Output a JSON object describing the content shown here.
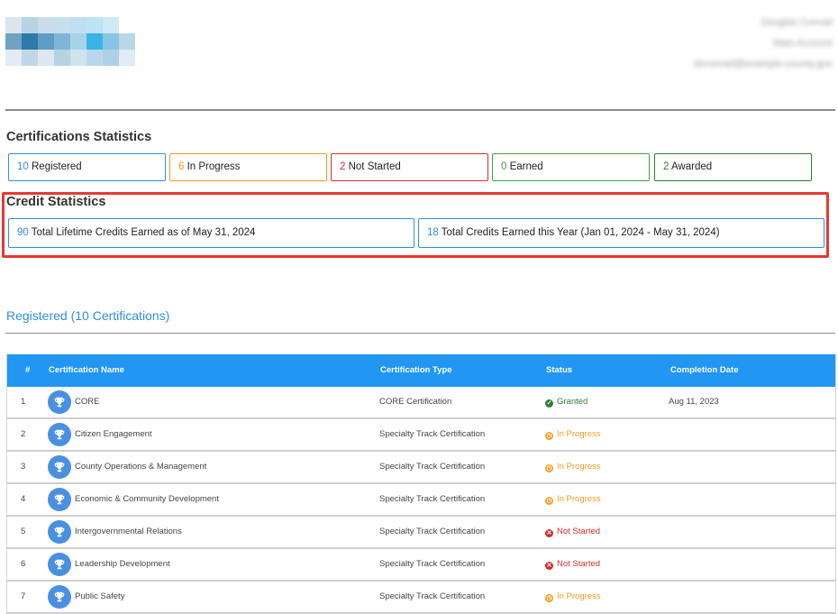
{
  "header": {
    "user_name": "Douglas Conrad",
    "user_role": "Main Account",
    "user_email": "doconrad@example-county.gov"
  },
  "cert_stats": {
    "title": "Certifications Statistics",
    "items": [
      {
        "count": "10",
        "label": " Registered",
        "color": "#2f8fe3"
      },
      {
        "count": "6",
        "label": " In Progress",
        "color": "#f39c1f"
      },
      {
        "count": "2",
        "label": " Not Started",
        "color": "#d32f2f"
      },
      {
        "count": "0",
        "label": " Earned",
        "color": "#43a047"
      },
      {
        "count": "2",
        "label": " Awarded",
        "color": "#2e7d32"
      }
    ]
  },
  "credit_stats": {
    "title": "Credit Statistics",
    "lifetime_count": "90",
    "lifetime_label": " Total Lifetime Credits Earned as of May 31, 2024",
    "year_count": "18",
    "year_label": " Total Credits Earned this Year (Jan 01, 2024 - May 31, 2024)"
  },
  "registered": {
    "title": "Registered (10 Certifications)",
    "columns": {
      "num": "#",
      "name": "Certification Name",
      "type": "Certification Type",
      "status": "Status",
      "date": "Completion Date"
    },
    "rows": [
      {
        "num": "1",
        "name": "CORE",
        "type": "CORE Certification",
        "status": "Granted",
        "status_kind": "granted",
        "date": "Aug 11, 2023"
      },
      {
        "num": "2",
        "name": "Citizen Engagement",
        "type": "Specialty Track Certification",
        "status": "In Progress",
        "status_kind": "progress",
        "date": ""
      },
      {
        "num": "3",
        "name": "County Operations & Management",
        "type": "Specialty Track Certification",
        "status": "In Progress",
        "status_kind": "progress",
        "date": ""
      },
      {
        "num": "4",
        "name": "Economic & Community Development",
        "type": "Specialty Track Certification",
        "status": "In Progress",
        "status_kind": "progress",
        "date": ""
      },
      {
        "num": "5",
        "name": "Intergovernmental Relations",
        "type": "Specialty Track Certification",
        "status": "Not Started",
        "status_kind": "notstarted",
        "date": ""
      },
      {
        "num": "6",
        "name": "Leadership Development",
        "type": "Specialty Track Certification",
        "status": "Not Started",
        "status_kind": "notstarted",
        "date": ""
      },
      {
        "num": "7",
        "name": "Public Safety",
        "type": "Specialty Track Certification",
        "status": "In Progress",
        "status_kind": "progress",
        "date": ""
      }
    ]
  },
  "colors": {
    "accent": "#2196f3",
    "granted": "#2e7d32",
    "progress": "#f39c1f",
    "notstarted": "#d32f2f",
    "highlight": "#e53935"
  }
}
